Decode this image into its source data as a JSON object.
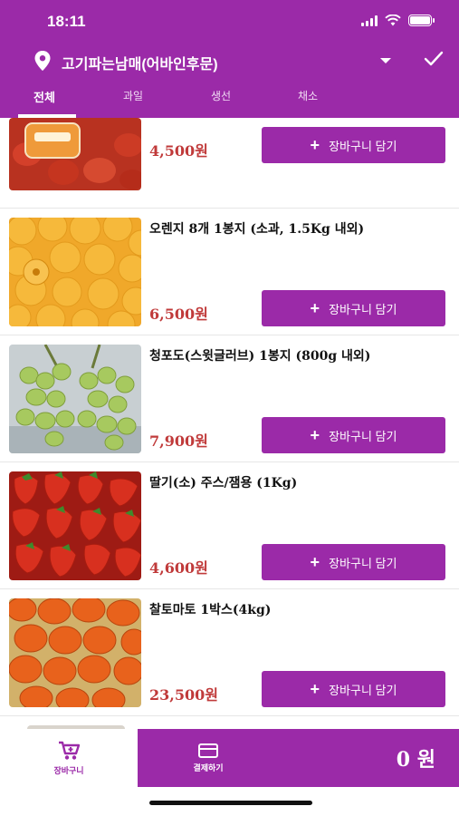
{
  "status_bar": {
    "time": "18:11"
  },
  "header": {
    "location": "고기파는남매(어바인후문)",
    "icons": {
      "location": "pin-icon",
      "dropdown": "dropdown-icon",
      "confirm": "check-icon"
    }
  },
  "tabs": [
    {
      "label": "전체",
      "active": true
    },
    {
      "label": "과일",
      "active": false
    },
    {
      "label": "생선",
      "active": false
    },
    {
      "label": "채소",
      "active": false
    }
  ],
  "products": [
    {
      "name": "",
      "price": "4,500원",
      "button": "장바구니 담기",
      "image": "strawberry-pack"
    },
    {
      "name": "오렌지 8개 1봉지 (소과, 1.5Kg 내외)",
      "price": "6,500원",
      "button": "장바구니 담기",
      "image": "oranges"
    },
    {
      "name": "청포도(스윗글러브) 1봉지 (800g 내외)",
      "price": "7,900원",
      "button": "장바구니 담기",
      "image": "green-grapes"
    },
    {
      "name": "딸기(소) 주스/잼용 (1Kg)",
      "price": "4,600원",
      "button": "장바구니 담기",
      "image": "strawberries"
    },
    {
      "name": "찰토마토 1박스(4kg)",
      "price": "23,500원",
      "button": "장바구니 담기",
      "image": "tomatoes"
    }
  ],
  "bottom_bar": {
    "cart_label": "장바구니",
    "pay_label": "결제하기",
    "total": "0 원",
    "colors": {
      "accent": "#9b2aa8",
      "price": "#c03a3a"
    }
  }
}
